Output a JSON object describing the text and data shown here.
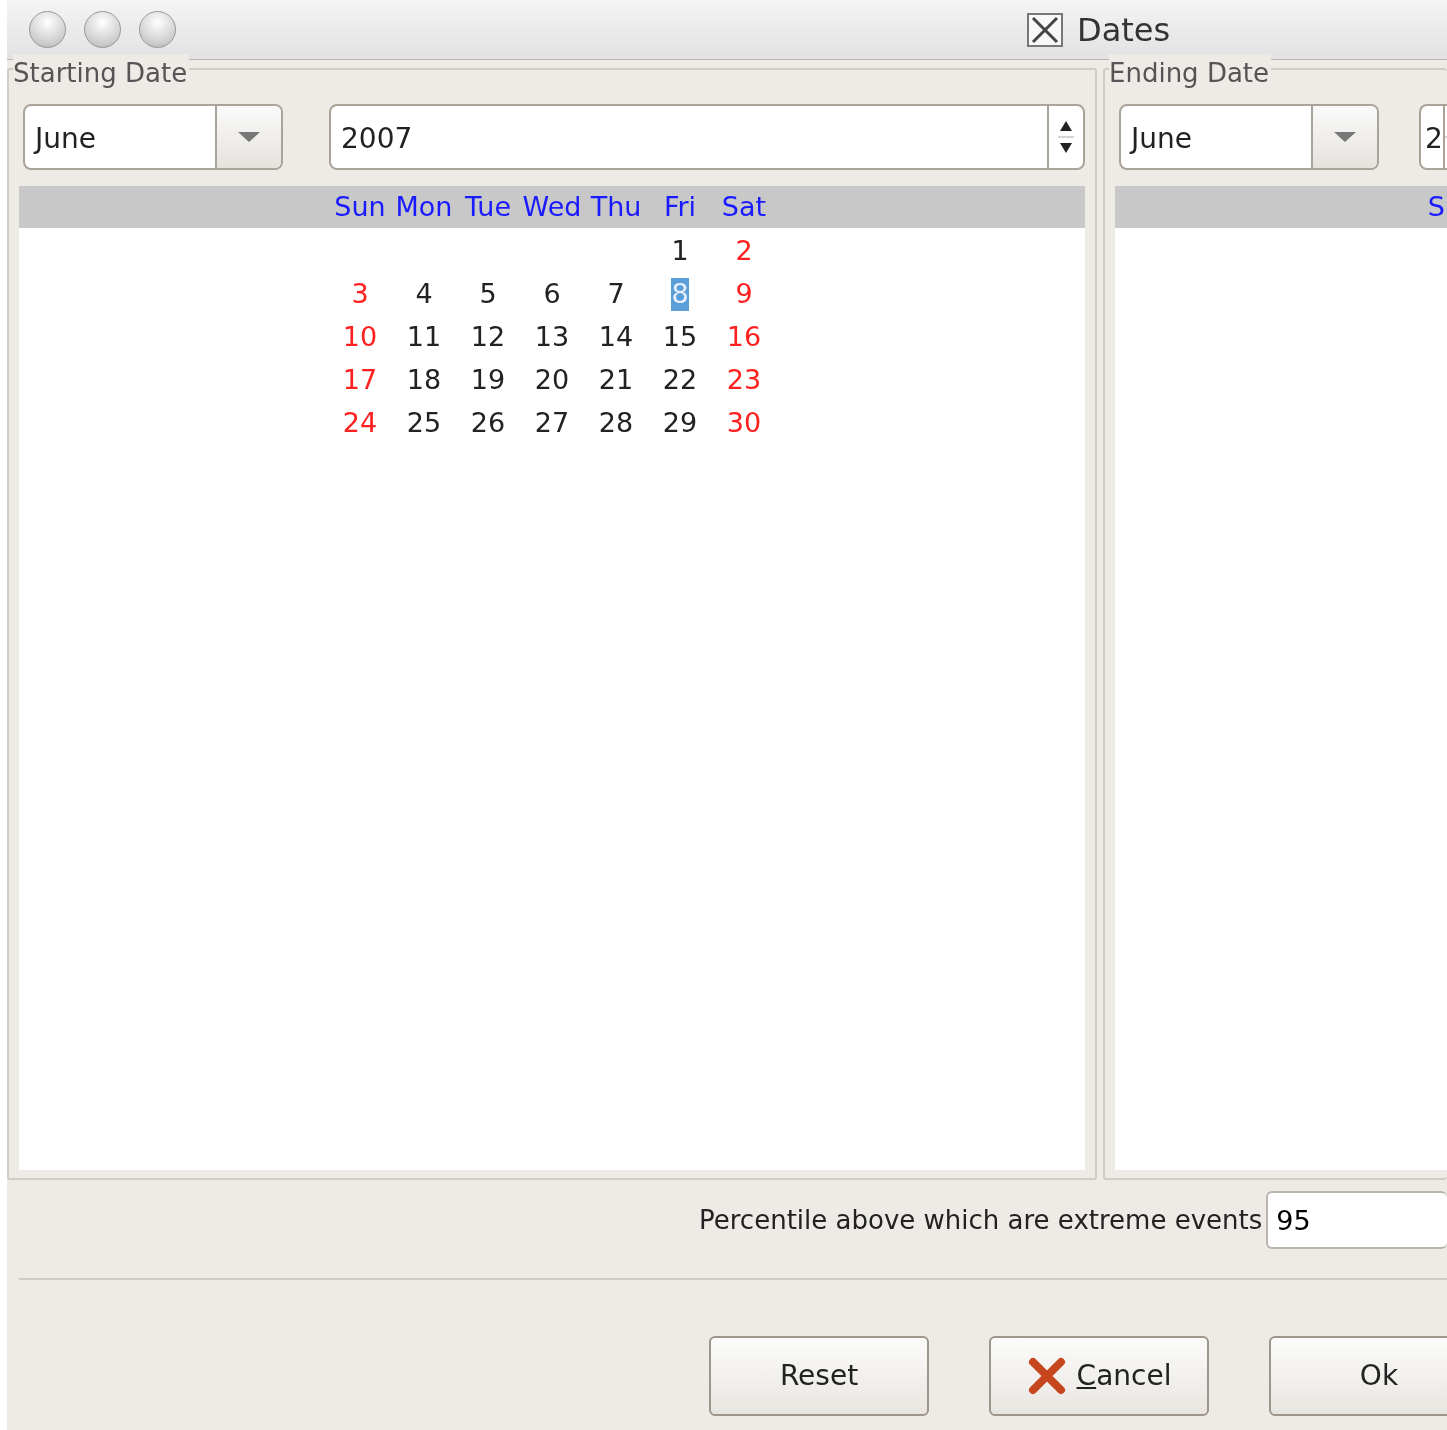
{
  "window": {
    "title": "Dates"
  },
  "starting": {
    "legend": "Starting Date",
    "month": "June",
    "year": "2007",
    "weekdays": [
      "Sun",
      "Mon",
      "Tue",
      "Wed",
      "Thu",
      "Fri",
      "Sat"
    ],
    "weeks": [
      [
        {
          "text": "1",
          "weekend": false,
          "selected": false
        },
        {
          "text": "2",
          "weekend": true,
          "selected": false
        }
      ],
      [
        {
          "text": "3",
          "weekend": true,
          "selected": false
        },
        {
          "text": "4",
          "weekend": false,
          "selected": false
        },
        {
          "text": "5",
          "weekend": false,
          "selected": false
        },
        {
          "text": "6",
          "weekend": false,
          "selected": false
        },
        {
          "text": "7",
          "weekend": false,
          "selected": false
        },
        {
          "text": "8",
          "weekend": false,
          "selected": true
        },
        {
          "text": "9",
          "weekend": true,
          "selected": false
        }
      ],
      [
        {
          "text": "10",
          "weekend": true,
          "selected": false
        },
        {
          "text": "11",
          "weekend": false,
          "selected": false
        },
        {
          "text": "12",
          "weekend": false,
          "selected": false
        },
        {
          "text": "13",
          "weekend": false,
          "selected": false
        },
        {
          "text": "14",
          "weekend": false,
          "selected": false
        },
        {
          "text": "15",
          "weekend": false,
          "selected": false
        },
        {
          "text": "16",
          "weekend": true,
          "selected": false
        }
      ],
      [
        {
          "text": "17",
          "weekend": true,
          "selected": false
        },
        {
          "text": "18",
          "weekend": false,
          "selected": false
        },
        {
          "text": "19",
          "weekend": false,
          "selected": false
        },
        {
          "text": "20",
          "weekend": false,
          "selected": false
        },
        {
          "text": "21",
          "weekend": false,
          "selected": false
        },
        {
          "text": "22",
          "weekend": false,
          "selected": false
        },
        {
          "text": "23",
          "weekend": true,
          "selected": false
        }
      ],
      [
        {
          "text": "24",
          "weekend": true,
          "selected": false
        },
        {
          "text": "25",
          "weekend": false,
          "selected": false
        },
        {
          "text": "26",
          "weekend": false,
          "selected": false
        },
        {
          "text": "27",
          "weekend": false,
          "selected": false
        },
        {
          "text": "28",
          "weekend": false,
          "selected": false
        },
        {
          "text": "29",
          "weekend": false,
          "selected": false
        },
        {
          "text": "30",
          "weekend": true,
          "selected": false
        }
      ]
    ]
  },
  "ending": {
    "legend": "Ending Date",
    "month": "June",
    "year": "2",
    "weekdays": [
      "S"
    ]
  },
  "percentile": {
    "label": "Percentile above which are extreme events",
    "value": "95"
  },
  "buttons": [
    {
      "label": "Reset",
      "kind": "plain",
      "mnemonic": false
    },
    {
      "label": "Cancel",
      "kind": "cancel",
      "mnemonic": true
    },
    {
      "label": "Ok",
      "kind": "plain",
      "mnemonic": false
    }
  ]
}
